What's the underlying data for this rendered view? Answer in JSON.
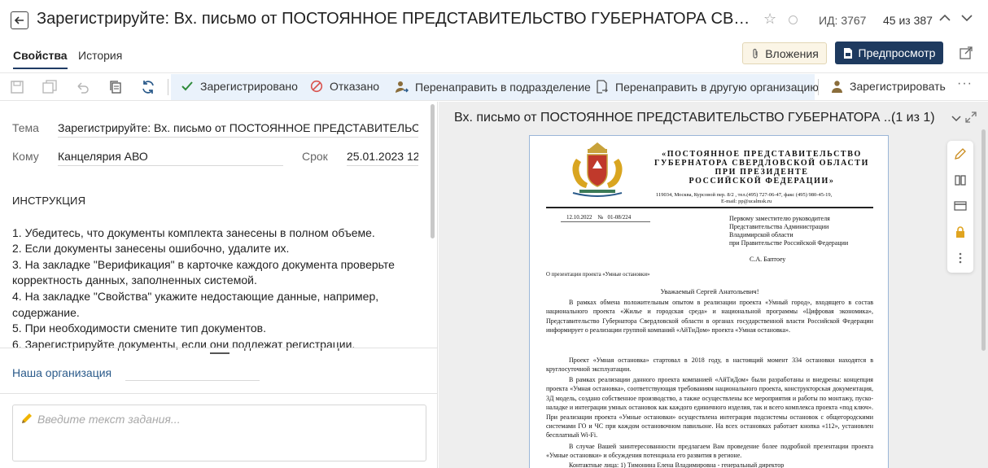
{
  "header": {
    "title": "Зарегистрируйте: Вх. письмо от ПОСТОЯННОЕ ПРЕДСТАВИТЕЛЬСТВО ГУБЕРНАТОРА СВЕРДЛО...",
    "doc_id": "ИД: 3767",
    "counter": "45 из 387"
  },
  "tabs": [
    {
      "label": "Свойства",
      "active": true
    },
    {
      "label": "История",
      "active": false
    }
  ],
  "buttons": {
    "attachments": "Вложения",
    "preview": "Предпросмотр"
  },
  "toolbar": {
    "actions": [
      {
        "label": "Зарегистрировано",
        "icon": "check-icon"
      },
      {
        "label": "Отказано",
        "icon": "forbidden-icon"
      },
      {
        "label": "Перенаправить в подразделение",
        "icon": "user-forward-icon"
      },
      {
        "label": "Перенаправить в другую организацию",
        "icon": "doc-forward-icon"
      }
    ],
    "register": "Зарегистрировать",
    "more": "···"
  },
  "form": {
    "subject_label": "Тема",
    "subject_value": "Зарегистрируйте: Вх. письмо от ПОСТОЯННОЕ ПРЕДСТАВИТЕЛЬСТВО ГУБЕРНАТОРА",
    "to_label": "Кому",
    "to_value": "Канцелярия АВО",
    "deadline_label": "Срок",
    "deadline_value": "25.01.2023 12",
    "instruction_title": "ИНСТРУКЦИЯ",
    "instruction_lines": [
      "1. Убедитесь, что документы комплекта занесены в полном объеме.",
      "2. Если документы занесены ошибочно, удалите их.",
      "3. На закладке \"Верификация\" в карточке каждого документа проверьте",
      "корректность данных, заполненных системой.",
      "4. На закладке \"Свойства\" укажите недостающие данные, например,",
      "содержание.",
      "5. При необходимости смените тип документов.",
      "6. Зарегистрируйте документы, если они подлежат регистрации."
    ],
    "our_org_label": "Наша организация",
    "task_placeholder": "Введите текст задания..."
  },
  "preview": {
    "title": "Вх. письмо от ПОСТОЯННОЕ ПРЕДСТАВИТЕЛЬСТВО ГУБЕРНАТОРА ...",
    "page_counter": "(1 из 1)",
    "letter": {
      "org_lines": [
        "«ПОСТОЯННОЕ ПРЕДСТАВИТЕЛЬСТВО",
        "ГУБЕРНАТОРА СВЕРДЛОВСКОЙ ОБЛАСТИ",
        "ПРИ ПРЕЗИДЕНТЕ",
        "РОССИЙСКОЙ ФЕДЕРАЦИИ»"
      ],
      "address_lines": [
        "119034, Москва, Курсовой пер. 8/2 , тел.(495) 727-06-47, факс (495) 980-45-19,",
        "E-mail: pp@ucalmsk.ru"
      ],
      "reg_date": "12.10.2022",
      "reg_no_label": "№",
      "reg_no": "01-08/224",
      "addressee_lines": [
        "Первому заместителю руководителя",
        "Представительства Администрации",
        "Владимирской области",
        "при Правительстве Российской Федерации"
      ],
      "signature": "С.А. Баптоеу",
      "subject": "О презентации проекта «Умные остановки»",
      "greeting": "Уважаемый Сергей Анатольевич!",
      "paragraphs": [
        "В рамках обмена положительным опытом в реализации проекта «Умный город», входящего в состав национального проекта «Жилье и городская среда» и национальной программы «Цифровая экономика», Представительство Губернатора Свердловской области в органах государственной власти Российской Федерации информирует о реализации группой компаний «АйТиДом» проекта «Умная остановка».",
        "Проект «Умная остановка» стартовал в 2018 году, в настоящий момент 334 остановки находятся в круглосуточной эксплуатации.",
        "В рамках реализации данного проекта компанией «АйТиДом» были разработаны и внедрены: концепция проекта «Умная остановка», соответствующая требованиям национального проекта, конструкторская документация, 3Д модель, создано собственное производство, а также осуществлены все мероприятия и работы по монтажу, пуско-наладке и интеграции умных остановок как каждого единичного изделия, так и всего комплекса проекта «под ключ». При реализации проекта «Умные остановки» осуществлена интеграция подсистемы остановок с общегородскими системами ГО и ЧС при каждом остановочном павильоне. На всех остановках работает кнопка «112», установлен бесплатный Wi-Fi.",
        "В случае Вашей заинтересованности предлагаем Вам проведение более подробной презентации проекта «Умные остановки» и обсуждения потенциала его развития в регионе.",
        "Контактные лица: 1) Тимонина Елена Владимировна - генеральный директор"
      ]
    }
  },
  "colors": {
    "primary_button": "#1e3a5f",
    "toolbar_highlight": "#eaf2fb",
    "accent_green": "#2e8b3a",
    "accent_red": "#d9534f",
    "link_blue": "#2a5a8a"
  }
}
